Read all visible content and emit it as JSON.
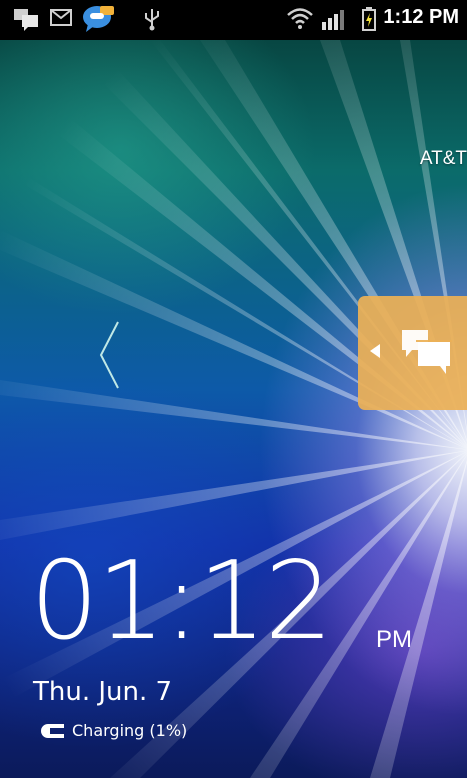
{
  "status_bar": {
    "notification_icons": [
      "chat-notification-icon",
      "gmail-icon",
      "talk-icon",
      "usb-icon"
    ],
    "system_icons": [
      "wifi-icon",
      "signal-icon",
      "battery-charging-icon"
    ],
    "time": "1:12 PM"
  },
  "carrier": "AT&T",
  "lock_screen": {
    "unlock_hint_icon": "chevron-left-icon",
    "messages_tab_icon": "messages-icon",
    "clock": {
      "time": "01:12",
      "ampm": "PM"
    },
    "date": "Thu. Jun. 7",
    "charging_status": "Charging (1%)"
  },
  "colors": {
    "accent_tab": "#ecb056",
    "text": "#ffffff"
  }
}
